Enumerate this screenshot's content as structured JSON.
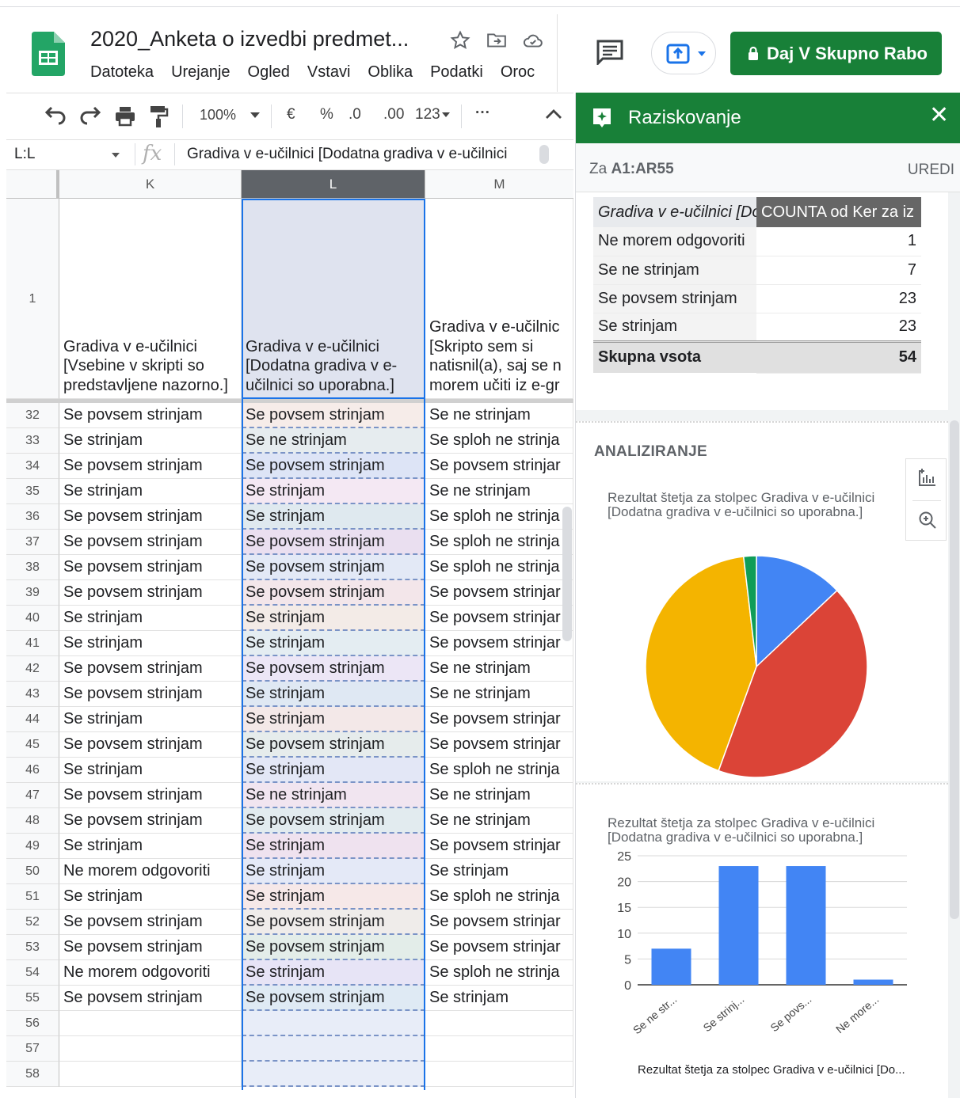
{
  "doc": {
    "title": "2020_Anketa o izvedbi predmet...",
    "menu": [
      "Datoteka",
      "Urejanje",
      "Ogled",
      "Vstavi",
      "Oblika",
      "Podatki",
      "Oroc"
    ]
  },
  "share_label": "Daj V Skupno Rabo",
  "toolbar": {
    "zoom": "100%",
    "currency": "€",
    "percent": "%",
    "dec_less": ".0",
    "dec_more": ".00",
    "format": "123",
    "more": "···"
  },
  "formula": {
    "namebox": "L:L",
    "fx": "fx",
    "content": "Gradiva v e-učilnici [Dodatna gradiva v e-učilnici"
  },
  "grid": {
    "columns": [
      "K",
      "L",
      "M"
    ],
    "header_row_number": "1",
    "header_cells": [
      "Gradiva v e-učilnici [Vsebine v skripti so predstavljene nazorno.]",
      "Gradiva v e-učilnici [Dodatna gradiva v e-učilnici so uporabna.]",
      "Gradiva v e-učilnic [Skripto sem si natisnil(a), saj se n morem učiti iz e-gr"
    ],
    "rows": [
      {
        "n": "32",
        "k": "Se povsem strinjam",
        "l": "Se povsem strinjam",
        "m": "Se ne strinjam"
      },
      {
        "n": "33",
        "k": "Se strinjam",
        "l": "Se ne strinjam",
        "m": "Se sploh ne strinja"
      },
      {
        "n": "34",
        "k": "Se povsem strinjam",
        "l": "Se povsem strinjam",
        "m": "Se povsem strinjar"
      },
      {
        "n": "35",
        "k": "Se strinjam",
        "l": "Se strinjam",
        "m": "Se ne strinjam"
      },
      {
        "n": "36",
        "k": "Se povsem strinjam",
        "l": "Se strinjam",
        "m": "Se sploh ne strinja"
      },
      {
        "n": "37",
        "k": "Se povsem strinjam",
        "l": "Se povsem strinjam",
        "m": "Se sploh ne strinja"
      },
      {
        "n": "38",
        "k": "Se povsem strinjam",
        "l": "Se povsem strinjam",
        "m": "Se sploh ne strinja"
      },
      {
        "n": "39",
        "k": "Se povsem strinjam",
        "l": "Se povsem strinjam",
        "m": "Se povsem strinjar"
      },
      {
        "n": "40",
        "k": "Se strinjam",
        "l": "Se strinjam",
        "m": "Se povsem strinjar"
      },
      {
        "n": "41",
        "k": "Se strinjam",
        "l": "Se strinjam",
        "m": "Se povsem strinjar"
      },
      {
        "n": "42",
        "k": "Se povsem strinjam",
        "l": "Se povsem strinjam",
        "m": "Se ne strinjam"
      },
      {
        "n": "43",
        "k": "Se povsem strinjam",
        "l": "Se strinjam",
        "m": "Se ne strinjam"
      },
      {
        "n": "44",
        "k": "Se strinjam",
        "l": "Se strinjam",
        "m": "Se povsem strinjar"
      },
      {
        "n": "45",
        "k": "Se povsem strinjam",
        "l": "Se povsem strinjam",
        "m": "Se povsem strinjar"
      },
      {
        "n": "46",
        "k": "Se strinjam",
        "l": "Se strinjam",
        "m": "Se sploh ne strinja"
      },
      {
        "n": "47",
        "k": "Se povsem strinjam",
        "l": "Se ne strinjam",
        "m": "Se ne strinjam"
      },
      {
        "n": "48",
        "k": "Se povsem strinjam",
        "l": "Se povsem strinjam",
        "m": "Se ne strinjam"
      },
      {
        "n": "49",
        "k": "Se strinjam",
        "l": "Se strinjam",
        "m": "Se povsem strinjar"
      },
      {
        "n": "50",
        "k": "Ne morem odgovoriti",
        "l": "Se strinjam",
        "m": "Se strinjam"
      },
      {
        "n": "51",
        "k": "Se strinjam",
        "l": "Se strinjam",
        "m": "Se sploh ne strinja"
      },
      {
        "n": "52",
        "k": "Se povsem strinjam",
        "l": "Se povsem strinjam",
        "m": "Se povsem strinjar"
      },
      {
        "n": "53",
        "k": "Se povsem strinjam",
        "l": "Se povsem strinjam",
        "m": "Se povsem strinjar"
      },
      {
        "n": "54",
        "k": "Ne morem odgovoriti",
        "l": "Se strinjam",
        "m": "Se sploh ne strinja"
      },
      {
        "n": "55",
        "k": "Se povsem strinjam",
        "l": "Se povsem strinjam",
        "m": "Se strinjam"
      },
      {
        "n": "56",
        "k": "",
        "l": "",
        "m": ""
      },
      {
        "n": "57",
        "k": "",
        "l": "",
        "m": ""
      },
      {
        "n": "58",
        "k": "",
        "l": "",
        "m": ""
      }
    ],
    "l_tints": [
      "#f6ece9",
      "#e6ecef",
      "#dde4f6",
      "#f4e8f3",
      "#dfe9ef",
      "#eadff0",
      "#e3e9f6",
      "#f3e6ea",
      "#f3ebe7",
      "#e4edf2",
      "#ece6f6",
      "#dfe8f3",
      "#f3e8e8",
      "#e6ecec",
      "#e3e7f6",
      "#f1e5f0",
      "#e2ebef",
      "#efe2ef",
      "#e4e9f7",
      "#f6e8e8",
      "#efecea",
      "#e3ede9",
      "#e7e4f6",
      "#dfeaf4",
      "#e8edf8",
      "#e8edf8",
      "#e8edf8"
    ]
  },
  "explore": {
    "title": "Raziskovanje",
    "range_prefix": "Za",
    "range": "A1:AR55",
    "edit": "UREDI",
    "pivot": {
      "headers": [
        "Gradiva v e-učilnici [Do",
        "COUNTA od Ker za iz"
      ],
      "rows": [
        {
          "label": "Ne morem odgovoriti",
          "value": "1"
        },
        {
          "label": "Se ne strinjam",
          "value": "7"
        },
        {
          "label": "Se povsem strinjam",
          "value": "23"
        },
        {
          "label": "Se strinjam",
          "value": "23"
        }
      ],
      "total_label": "Skupna vsota",
      "total_value": "54"
    },
    "analyze_label": "ANALIZIRANJE",
    "pie_title_1": "Rezultat štetja za stolpec Gradiva v e-učilnici",
    "pie_title_2": "[Dodatna gradiva v e-učilnici so uporabna.]",
    "bar_title_1": "Rezultat štetja za stolpec Gradiva v e-učilnici",
    "bar_title_2": "[Dodatna gradiva v e-učilnici so uporabna.]",
    "bar_xlabel": "Rezultat štetja za stolpec Gradiva v e-učilnici [Do..."
  },
  "chart_data": [
    {
      "type": "pie",
      "title": "Rezultat štetja za stolpec Gradiva v e-učilnici [Dodatna gradiva v e-učilnici so uporabna.]",
      "slices": [
        {
          "label": "Se ne strinjam",
          "value": 7,
          "color": "#4285f4"
        },
        {
          "label": "Se strinjam",
          "value": 23,
          "color": "#db4437"
        },
        {
          "label": "Se povsem strinjam",
          "value": 23,
          "color": "#f4b400"
        },
        {
          "label": "Ne morem odgovoriti",
          "value": 1,
          "color": "#0f9d58"
        }
      ]
    },
    {
      "type": "bar",
      "title": "Rezultat štetja za stolpec Gradiva v e-učilnici [Dodatna gradiva v e-učilnici so uporabna.]",
      "categories": [
        "Se ne str...",
        "Se strinj...",
        "Se povs...",
        "Ne more..."
      ],
      "values": [
        7,
        23,
        23,
        1
      ],
      "color": "#4285f4",
      "xlabel": "Rezultat štetja za stolpec Gradiva v e-učilnici [Do...",
      "ylim": [
        0,
        25
      ],
      "yticks": [
        "25",
        "20",
        "15",
        "10",
        "5",
        "0"
      ]
    }
  ]
}
